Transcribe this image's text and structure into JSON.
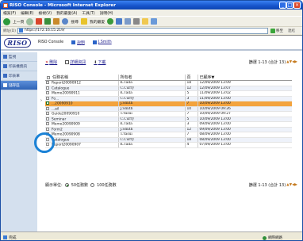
{
  "window": {
    "title": "RISO Console - Microsoft Internet Explorer",
    "buttons": [
      "_",
      "□",
      "×"
    ]
  },
  "menu": [
    "檔案(F)",
    "編輯(E)",
    "檢視(V)",
    "我的最愛(A)",
    "工具(T)",
    "說明(H)"
  ],
  "toolbar": {
    "back_label": "上一頁",
    "search_label": "搜尋",
    "favorites_label": "我的最愛"
  },
  "address": {
    "label": "網址(D)",
    "url": "https://172.16.15.219/",
    "go_label": "移至",
    "links_label": "連結"
  },
  "header": {
    "logo": "RISO",
    "app_name": "RISO Console",
    "link1": "說明",
    "link2": "J.Smith"
  },
  "sidebar": {
    "items": [
      {
        "label": "監視"
      },
      {
        "label": "印表機資訊"
      },
      {
        "label": "印表單"
      },
      {
        "label": "儲存區",
        "active": true
      }
    ]
  },
  "actions": {
    "delete": "刪除",
    "details": "詳細資訊",
    "download": "下載"
  },
  "count_text": "篩選 1-13 (合計 13)",
  "table": {
    "headers": [
      "任務名稱",
      "所有者",
      "頁",
      "已顯序▼"
    ],
    "rows": [
      {
        "name": "Report20090912",
        "owner": "K.Tada",
        "pages": "18",
        "date": "12/09/2009 13:09",
        "checked": false
      },
      {
        "name": "Catalogue",
        "owner": "C.Curry",
        "pages": "12",
        "date": "12/09/2009 13:07",
        "checked": false
      },
      {
        "name": "Memo20090911",
        "owner": "K.Tada",
        "pages": "5",
        "date": "11/09/2009 13:02",
        "checked": false
      },
      {
        "name": "Fo...",
        "owner": "C.Curry",
        "pages": "3",
        "date": "11/09/2009 13:00",
        "checked": false
      },
      {
        "name": "...20090910",
        "owner": "J.Smith",
        "pages": "7",
        "date": "10/09/2009 13:00",
        "checked": true,
        "selected": true
      },
      {
        "name": "...ail",
        "owner": "J.Smith",
        "pages": "10",
        "date": "10/09/2009 09:26",
        "checked": false
      },
      {
        "name": "Guide20090910",
        "owner": "T.Yasui",
        "pages": "7",
        "date": "10/09/2009 09:27",
        "checked": false
      },
      {
        "name": "Seminar",
        "owner": "C.Curry",
        "pages": "5",
        "date": "10/09/2009 13:00",
        "checked": false
      },
      {
        "name": "Memo20090909",
        "owner": "K.Tada",
        "pages": "3",
        "date": "09/09/2009 13:00",
        "checked": false
      },
      {
        "name": "Form2",
        "owner": "J.Smith",
        "pages": "12",
        "date": "09/09/2009 13:00",
        "checked": false
      },
      {
        "name": "Memo20090908",
        "owner": "T.Yasui",
        "pages": "7",
        "date": "08/09/2009 13:00",
        "checked": false
      },
      {
        "name": "Catalogue",
        "owner": "C.Curry",
        "pages": "18",
        "date": "08/09/2009 13:00",
        "checked": false
      },
      {
        "name": "Report20090907",
        "owner": "K.Tada",
        "pages": "4",
        "date": "07/09/2009 13:00",
        "checked": false
      }
    ]
  },
  "per_page": {
    "label": "顯示單位:",
    "option1": "50任務數",
    "option2": "100任務數"
  },
  "status": {
    "text": "完成",
    "zone": "網際網路"
  }
}
